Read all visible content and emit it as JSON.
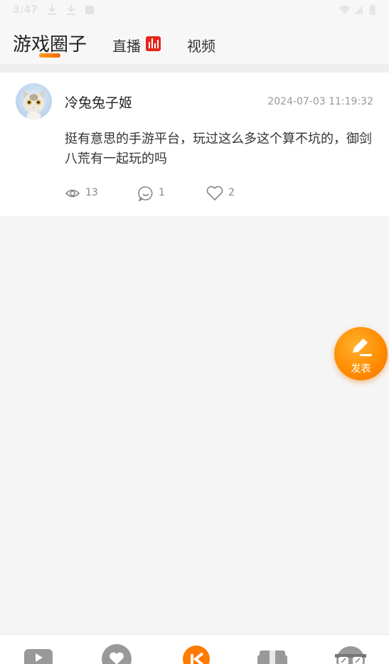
{
  "status_bar": {
    "time": "3:47",
    "icons": [
      "download-icon",
      "download-icon",
      "notification-icon",
      "wifi-icon",
      "signal-icon",
      "battery-icon"
    ]
  },
  "header": {
    "tabs": [
      {
        "label": "游戏圈子",
        "active": true
      },
      {
        "label": "直播",
        "badge": "live-bars-icon"
      },
      {
        "label": "视频"
      }
    ],
    "accent_color": "#ff8a00"
  },
  "post": {
    "username": "冷兔兔子姬",
    "timestamp": "2024-07-03 11:19:32",
    "content": "挺有意思的手游平台，玩过这么多这个算不坑的，御剑八荒有一起玩的吗",
    "stats": {
      "views": "13",
      "comments": "1",
      "likes": "2"
    }
  },
  "fab": {
    "label": "发表",
    "icon": "pencil-icon"
  },
  "bottom_nav": {
    "items": [
      "game-icon",
      "heart-icon",
      "circle-home-icon",
      "gift-icon",
      "sunglasses-icon"
    ]
  }
}
